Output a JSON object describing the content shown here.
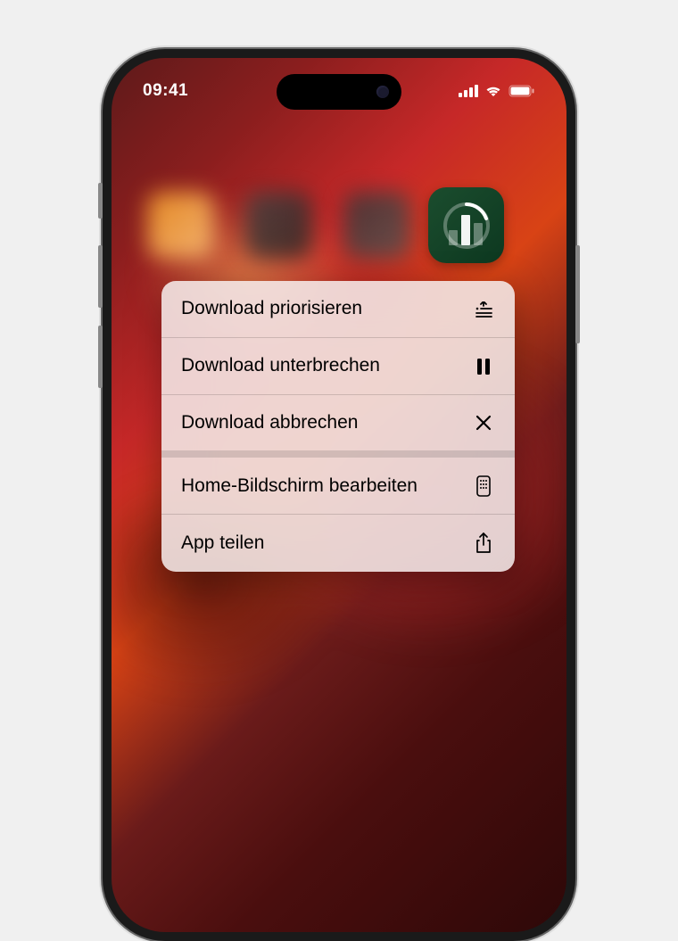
{
  "status_bar": {
    "time": "09:41"
  },
  "menu": {
    "items": [
      {
        "label": "Download priorisieren",
        "icon": "priority"
      },
      {
        "label": "Download unterbrechen",
        "icon": "pause"
      },
      {
        "label": "Download abbrechen",
        "icon": "cancel"
      },
      {
        "label": "Home-Bildschirm bearbeiten",
        "icon": "edit-home"
      },
      {
        "label": "App teilen",
        "icon": "share"
      }
    ]
  }
}
